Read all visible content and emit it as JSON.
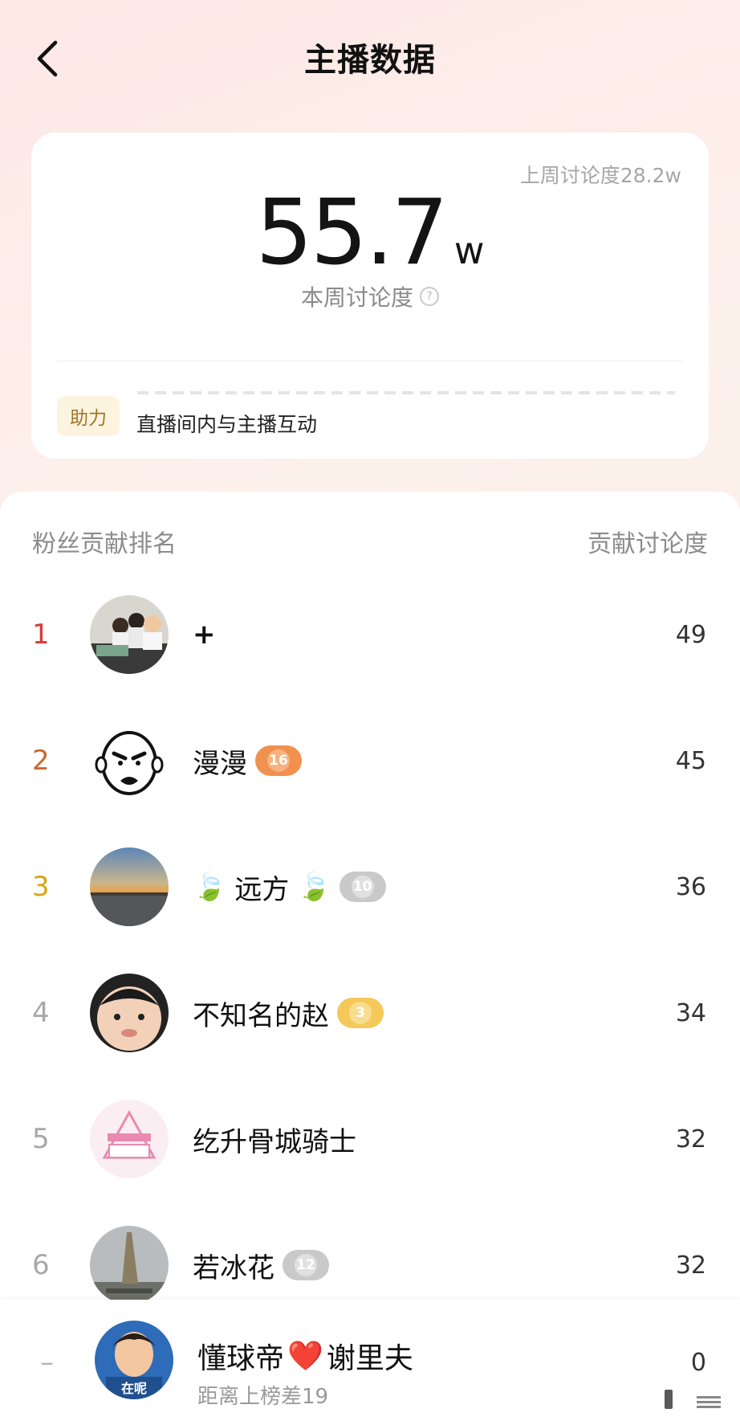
{
  "header": {
    "title": "主播数据"
  },
  "summary": {
    "last_week": "上周讨论度28.2w",
    "value": "55.7",
    "unit": "w",
    "label": "本周讨论度",
    "help_icon": "question-circle-icon",
    "tag": "助力",
    "tip": "直播间内与主播互动"
  },
  "ranking": {
    "left_header": "粉丝贡献排名",
    "right_header": "贡献讨论度",
    "rank_colors": {
      "1": "#d93a3a",
      "2": "#c8692c",
      "3": "#d8a515",
      "other": "#a8a8a8"
    },
    "rows": [
      {
        "rank": "1",
        "name": "+",
        "badge": "",
        "value": "49"
      },
      {
        "rank": "2",
        "name": "漫漫",
        "badge": "16",
        "badge_color": "#f0914f",
        "value": "45"
      },
      {
        "rank": "3",
        "name_prefix": "🍃",
        "name": "远方",
        "name_suffix": "🍃",
        "badge": "10",
        "badge_color": "#c9c9c9",
        "value": "36"
      },
      {
        "rank": "4",
        "name": "不知名的赵",
        "badge": "3",
        "badge_color": "#f4c95a",
        "value": "34"
      },
      {
        "rank": "5",
        "name": "纥升骨城骑士",
        "badge": "",
        "value": "32"
      },
      {
        "rank": "6",
        "name": "若冰花",
        "badge": "12",
        "badge_color": "#c9c9c9",
        "value": "32"
      }
    ]
  },
  "me": {
    "rank": "–",
    "name_a": "懂球帝",
    "heart": "❤️",
    "name_b": "谢里夫",
    "sub": "距离上榜差19",
    "value": "0",
    "avatar_text": "在呢"
  }
}
